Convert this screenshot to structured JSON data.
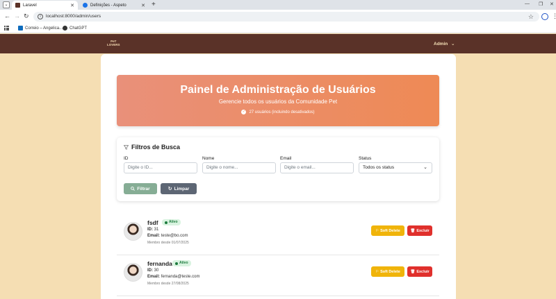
{
  "browser": {
    "tabs": [
      {
        "label": "Laravel",
        "active": true,
        "color": "#5a3228"
      },
      {
        "label": "Definições - Aspeto",
        "active": false,
        "color": "#1a73e8"
      }
    ],
    "url": "localhost:8000/admin/users",
    "bookmarks": [
      {
        "label": "Correio – Angelica...",
        "icon": "outlook-icon",
        "color": "#0f6cbd"
      },
      {
        "label": "ChatGPT",
        "icon": "chatgpt-icon",
        "color": "#333333"
      }
    ]
  },
  "navbar": {
    "logo_line1": "PeT",
    "logo_line2": "LOVERS",
    "admin_label": "Admin",
    "background": "#5a3228"
  },
  "hero": {
    "title": "Painel de Administração de Usuários",
    "subtitle": "Gerencie todos os usuários da Comunidade Pet",
    "count_text": "27 usuários (incluindo desativados)"
  },
  "filters": {
    "heading": "Filtros de Busca",
    "fields": [
      {
        "label": "ID",
        "placeholder": "Digite o ID..."
      },
      {
        "label": "Nome",
        "placeholder": "Digite o nome..."
      },
      {
        "label": "Email",
        "placeholder": "Digite o email..."
      },
      {
        "label": "Status",
        "value": "Todos os status"
      }
    ],
    "filter_button": "Filtrar",
    "clear_button": "Limpar"
  },
  "users": [
    {
      "name": "fsdf",
      "status": "Ativo",
      "id_label": "ID:",
      "id": "31",
      "email_label": "Email:",
      "email": "teste@bo.com",
      "since": "Membro desde 01/07/2025",
      "soft_delete": "Soft Delete",
      "delete": "Excluir"
    },
    {
      "name": "fernanda",
      "status": "Ativo",
      "id_label": "ID:",
      "id": "30",
      "email_label": "Email:",
      "email": "fernanda@teste.com",
      "since": "Membro desde 27/08/2025",
      "soft_delete": "Soft Delete",
      "delete": "Excluir"
    }
  ]
}
